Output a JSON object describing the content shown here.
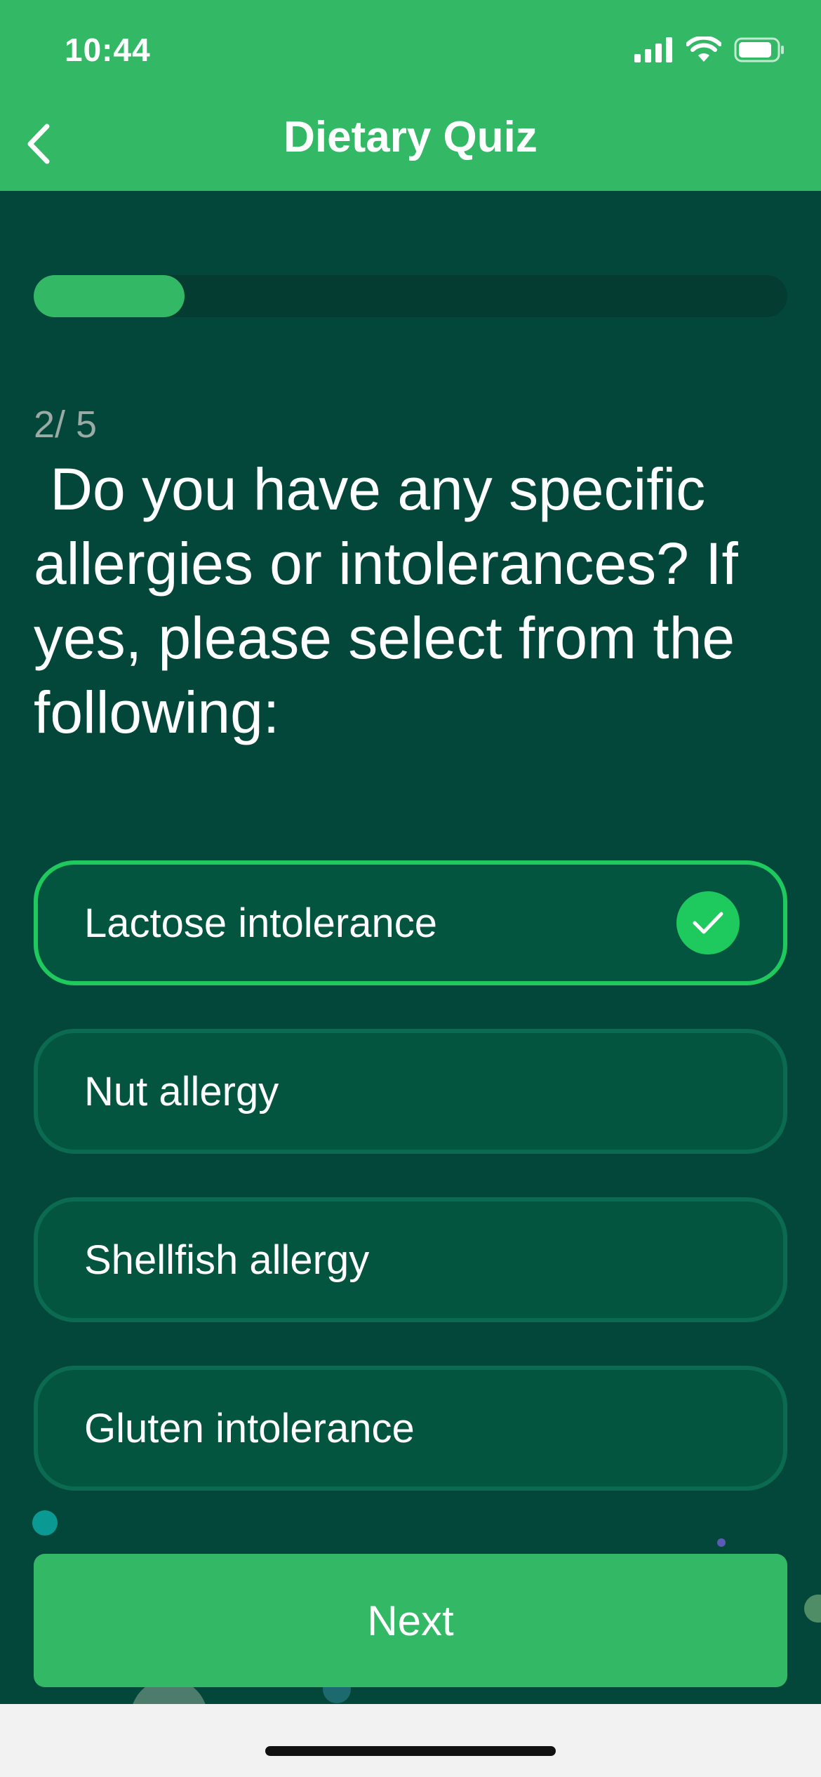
{
  "status_bar": {
    "time": "10:44"
  },
  "header": {
    "title": "Dietary Quiz"
  },
  "progress": {
    "current": 2,
    "total": 5,
    "fraction": 0.2
  },
  "question": {
    "counter": "2/ 5",
    "text": " Do you have any specific allergies or intolerances? If yes, please select from the following:"
  },
  "options": [
    {
      "label": "Lactose intolerance",
      "selected": true
    },
    {
      "label": "Nut allergy",
      "selected": false
    },
    {
      "label": "Shellfish allergy",
      "selected": false
    },
    {
      "label": "Gluten intolerance",
      "selected": false
    }
  ],
  "footer": {
    "next_label": "Next"
  },
  "colors": {
    "header_green": "#33b866",
    "background_dark": "#03473a",
    "selected_border": "#1ec95d",
    "option_fill": "#04553f"
  }
}
